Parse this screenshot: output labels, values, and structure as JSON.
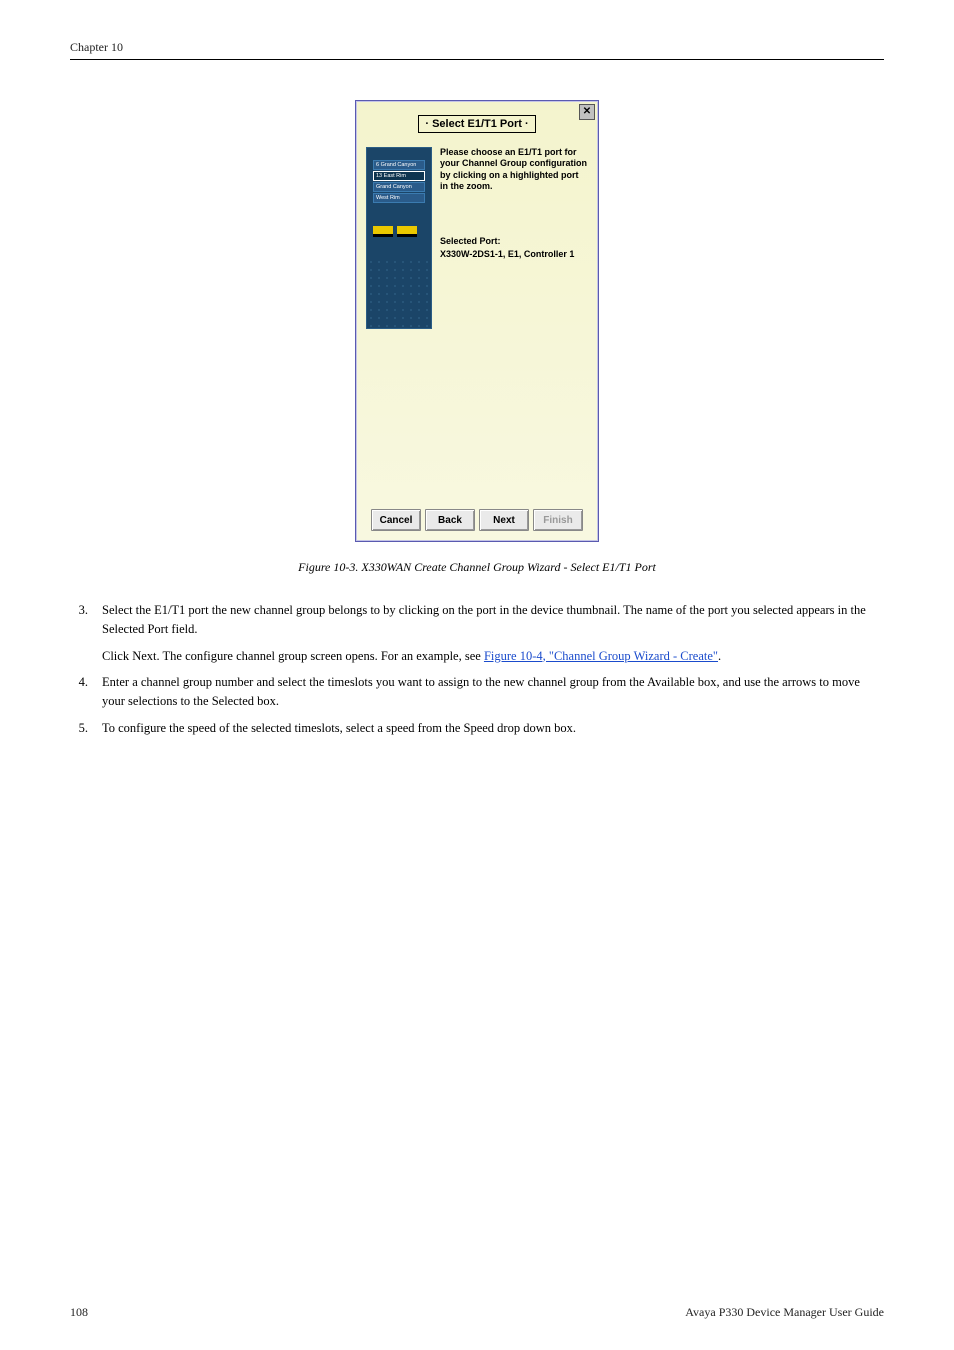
{
  "header": {
    "chapter": "Chapter 10"
  },
  "dialog": {
    "title": "· Select E1/T1 Port ·",
    "instruction": "Please choose an E1/T1 port for your Channel Group configuration by clicking on a highlighted port in the zoom.",
    "selected_port_label": "Selected Port:",
    "selected_port_value": "X330W-2DS1-1, E1, Controller 1",
    "map": [
      "6  Grand Canyon",
      "13  East Rim",
      "Grand Canyon",
      "West Rim"
    ],
    "buttons": {
      "cancel": "Cancel",
      "back": "Back",
      "next": "Next",
      "finish": "Finish"
    }
  },
  "figure": {
    "caption": "Figure 10-3. X330WAN Create Channel Group Wizard - Select E1/T1 Port"
  },
  "steps": [
    {
      "num": "3.",
      "text": "Select the E1/T1 port the new channel group belongs to by clicking on the port in the device thumbnail. The name of the port you selected appears in the Selected Port field.",
      "sub_pre": "Click Next. The configure channel group screen opens. For an example, see ",
      "link": "Figure 10-4, \"Channel Group Wizard - Create\"",
      "sub_post": "."
    },
    {
      "num": "4.",
      "text": "Enter a channel group number and select the timeslots you want to assign to the new channel group from the Available box, and use the arrows to move your selections to the Selected box."
    },
    {
      "num": "5.",
      "text": "To configure the speed of the selected timeslots, select a speed from the Speed drop down box."
    }
  ],
  "footer": {
    "page": "108",
    "doc": "Avaya P330 Device Manager User Guide"
  }
}
